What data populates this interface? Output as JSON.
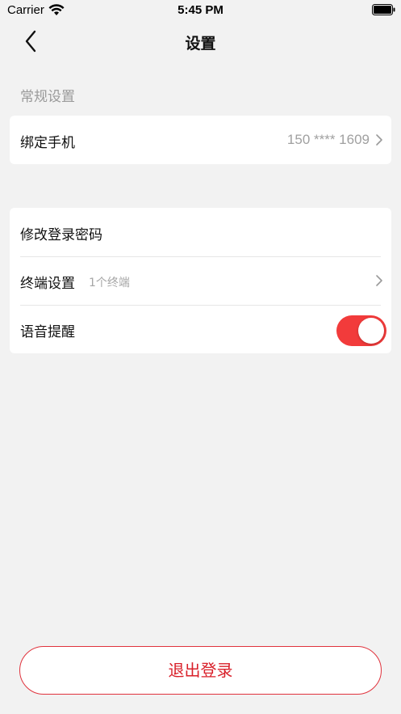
{
  "status_bar": {
    "carrier": "Carrier",
    "time": "5:45 PM"
  },
  "nav": {
    "title": "设置",
    "back_icon": "chevron-left-icon"
  },
  "section": {
    "general_label": "常规设置"
  },
  "bind_phone": {
    "label": "绑定手机",
    "value": "150 **** 1609"
  },
  "rows": {
    "change_password": {
      "label": "修改登录密码"
    },
    "terminal": {
      "label": "终端设置",
      "sub": "1个终端"
    },
    "voice": {
      "label": "语音提醒",
      "enabled": true
    }
  },
  "logout": {
    "label": "退出登录"
  },
  "colors": {
    "background": "#f2f2f2",
    "accent": "#f23b3b",
    "logout_text": "#d9202a"
  }
}
